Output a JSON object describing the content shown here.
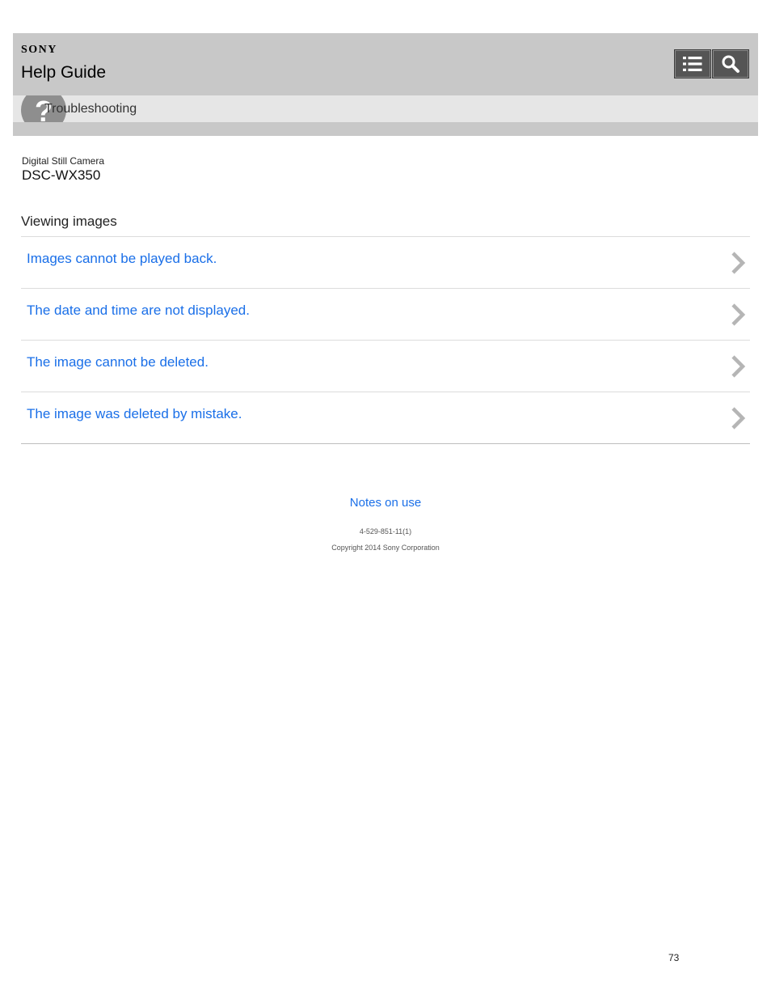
{
  "header": {
    "brand": "SONY",
    "title": "Help Guide",
    "menu_icon": "list-menu-icon",
    "search_icon": "search-icon"
  },
  "breadcrumb": {
    "icon": "question-mark-icon",
    "label": "Troubleshooting"
  },
  "product": {
    "category": "Digital Still Camera",
    "model": "DSC-WX350"
  },
  "section": {
    "title": "Viewing images",
    "items": [
      {
        "label": "Images cannot be played back."
      },
      {
        "label": "The date and time are not displayed."
      },
      {
        "label": "The image cannot be deleted."
      },
      {
        "label": "The image was deleted by mistake."
      }
    ]
  },
  "footer": {
    "notes_link": "Notes on use",
    "doc_number": "4-529-851-11(1)",
    "copyright": "Copyright 2014 Sony Corporation"
  },
  "page_number": "73",
  "colors": {
    "header_bg": "#c8c8c8",
    "breadcrumb_bg": "#e6e6e6",
    "link": "#1a6fe8",
    "button_bg": "#555555",
    "chevron": "#b5b5b5"
  }
}
